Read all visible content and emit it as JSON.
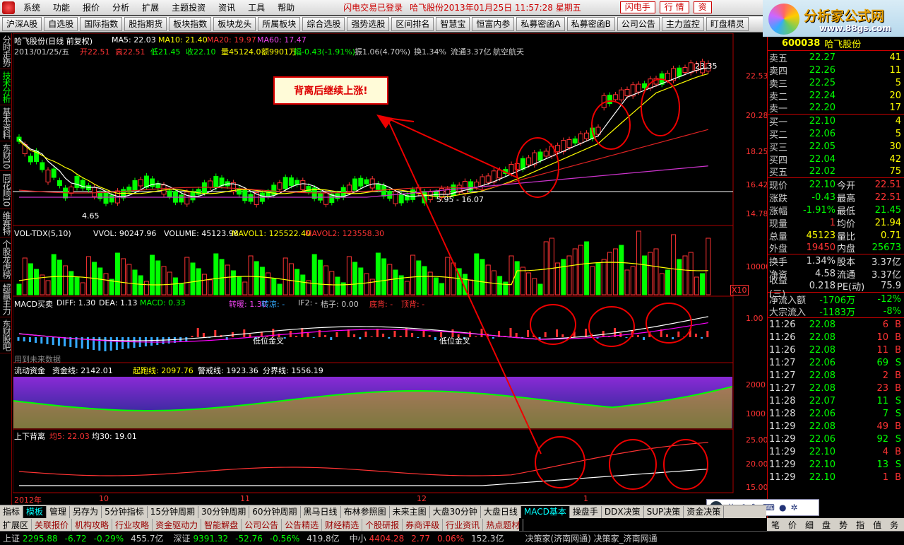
{
  "menu": {
    "items": [
      "系统",
      "功能",
      "报价",
      "分析",
      "扩展",
      "主题投资",
      "资讯",
      "工具",
      "帮助"
    ],
    "status": "闪电交易已登录",
    "stock_title": "哈飞股份2013年01月25日 11:57:28 星期五",
    "btn_flash": "闪电手",
    "btn_quote": "行 情",
    "btn_capital": "资"
  },
  "brand": {
    "title": "分析家公式网",
    "url": "www.88gs.com"
  },
  "toolbar": [
    "沪深A股",
    "自选股",
    "国际指数",
    "股指期货",
    "板块指数",
    "板块龙头",
    "所属板块",
    "综合选股",
    "强势选股",
    "区间排名",
    "智慧宝",
    "恒富内参",
    "私募密函A",
    "私募密函B",
    "公司公告",
    "主力监控",
    "盯盘精灵"
  ],
  "leftnav": [
    "分时走势",
    "技术分析",
    "基本资料",
    "东财10",
    "同花顺10",
    "维赛特",
    "个股龙虎榜",
    "超赢主力",
    "东财股吧"
  ],
  "header": {
    "line1": "哈飞股份(日线 前复权)",
    "ma5": "MA5: 22.03",
    "ma10": "MA10: 21.40",
    "ma20": "MA20: 19.97",
    "ma60": "MA60: 17.47",
    "date": "2013/01/25/五",
    "open": "开22.51",
    "high": "高22.51",
    "low": "低21.45",
    "close": "收22.10",
    "vol": "量45124.0",
    "amt": "额9901万",
    "chg": "幅-0.43(-1.91%)",
    "amp": "振1.06(4.70%)",
    "turn": "换1.34%",
    "float": "流通3.37亿",
    "sector": "航空航天"
  },
  "price_labels": [
    "22.53",
    "20.28",
    "18.25",
    "16.42",
    "14.78"
  ],
  "price_annot": {
    "hi": "23.35",
    "lo": "4.65",
    "range": "5.95 - 16.07"
  },
  "annotation": "背离后继续上涨!",
  "vol": {
    "title": "VOL-TDX(5,10)",
    "vvol": "VVOL: 90247.96",
    "volume": "VOLUME: 45123.98",
    "mavol1": "MAVOL1: 125522.40",
    "mavol2": "MAVOL2: 123558.30",
    "axis": "10000",
    "mult": "X10"
  },
  "macd": {
    "title": "MACD买卖",
    "diff": "DIFF: 1.30",
    "dea": "DEA: 1.13",
    "macd": "MACD: 0.33",
    "zn": "转暖: 1.30",
    "zl": "转凉: -",
    "if2": "IF2: -",
    "gz": "桔子: 0.00",
    "db": "底背: -",
    "dingb": "顶背: -",
    "axis": "1.00",
    "sig1": "低位金叉",
    "sig2": "低位金叉",
    "note": "用到未来数据"
  },
  "fund": {
    "title": "流动资金",
    "zj": "资金线: 2142.01",
    "qp": "起跑线: 2097.76",
    "jj": "警戒线: 1923.36",
    "fj": "分界线: 1556.19",
    "a1": "2000",
    "a2": "1000"
  },
  "div": {
    "title": "上下背离",
    "j5": "均5: 22.03",
    "j30": "均30: 19.01",
    "a1": "25.00",
    "a2": "20.00",
    "a3": "15.00",
    "mark": "背"
  },
  "xaxis": [
    "2012年",
    "10",
    "11",
    "12",
    "1"
  ],
  "quote": {
    "code": "600038",
    "name": "哈飞股份",
    "asks": [
      [
        "卖五",
        "22.27",
        "41"
      ],
      [
        "卖四",
        "22.26",
        "11"
      ],
      [
        "卖三",
        "22.25",
        "5"
      ],
      [
        "卖二",
        "22.24",
        "20"
      ],
      [
        "卖一",
        "22.20",
        "17"
      ]
    ],
    "bids": [
      [
        "买一",
        "22.10",
        "4"
      ],
      [
        "买二",
        "22.06",
        "5"
      ],
      [
        "买三",
        "22.05",
        "30"
      ],
      [
        "买四",
        "22.04",
        "42"
      ],
      [
        "买五",
        "22.02",
        "75"
      ]
    ],
    "stats": [
      [
        "现价",
        "22.10",
        "今开",
        "22.51"
      ],
      [
        "涨跌",
        "-0.43",
        "最高",
        "22.51"
      ],
      [
        "涨幅",
        "-1.91%",
        "最低",
        "21.45"
      ],
      [
        "现量",
        "1",
        "均价",
        "21.94"
      ],
      [
        "总量",
        "45123",
        "量比",
        "0.71"
      ],
      [
        "外盘",
        "19450",
        "内盘",
        "25673"
      ]
    ],
    "stats2": [
      [
        "换手",
        "1.34%",
        "股本",
        "3.37亿"
      ],
      [
        "净资",
        "4.58",
        "流通",
        "3.37亿"
      ],
      [
        "收益(三)",
        "0.218",
        "PE(动)",
        "75.9"
      ]
    ],
    "flow": [
      [
        "净流入额",
        "-1706万",
        "-12%"
      ],
      [
        "大宗流入",
        "-1183万",
        "-8%"
      ]
    ],
    "ticks": [
      [
        "11:26",
        "22.08",
        "6",
        "B"
      ],
      [
        "11:26",
        "22.08",
        "10",
        "B"
      ],
      [
        "11:26",
        "22.08",
        "11",
        "B"
      ],
      [
        "11:27",
        "22.06",
        "69",
        "S"
      ],
      [
        "11:27",
        "22.08",
        "2",
        "B"
      ],
      [
        "11:27",
        "22.08",
        "23",
        "B"
      ],
      [
        "11:28",
        "22.07",
        "11",
        "S"
      ],
      [
        "11:28",
        "22.06",
        "7",
        "S"
      ],
      [
        "11:29",
        "22.08",
        "49",
        "B"
      ],
      [
        "11:29",
        "22.06",
        "92",
        "S"
      ],
      [
        "11:29",
        "22.10",
        "4",
        "B"
      ],
      [
        "11:29",
        "22.10",
        "13",
        "S"
      ],
      [
        "11:29",
        "22.10",
        "1",
        "B"
      ]
    ]
  },
  "tabs1": [
    "指标",
    "模板",
    "管理",
    "另存为",
    "5分钟指标",
    "15分钟周期",
    "30分钟周期",
    "60分钟周期",
    "黑马日线",
    "布林参照图",
    "未来主图",
    "大盘30分钟",
    "大盘日线",
    "MACD基本",
    "操盘手",
    "DDX决策",
    "SUP决策",
    "资金决策"
  ],
  "tabs2": [
    "扩展区",
    "关联报价",
    "机构攻略",
    "行业攻略",
    "资金驱动力",
    "智能解盘",
    "公司公告",
    "公告精选",
    "财经精选",
    "个股研报",
    "券商评级",
    "行业资讯",
    "热点题材"
  ],
  "rp_tabs": [
    "笔",
    "价",
    "细",
    "盘",
    "势",
    "指",
    "值",
    "务"
  ],
  "status": {
    "sh": "上证",
    "sh_v": "2295.88",
    "sh_c": "-6.72",
    "sh_p": "-0.29%",
    "sh_a": "455.7亿",
    "sz": "深证",
    "sz_v": "9391.32",
    "sz_c": "-52.76",
    "sz_p": "-0.56%",
    "sz_a": "419.8亿",
    "zx": "中小",
    "zx_v": "4404.28",
    "zx_c": "2.77",
    "zx_p": "0.06%",
    "zx_a": "152.3亿",
    "news": "决策家(济南网通)  决策家_济南网通"
  },
  "ime": {
    "label": "英"
  }
}
